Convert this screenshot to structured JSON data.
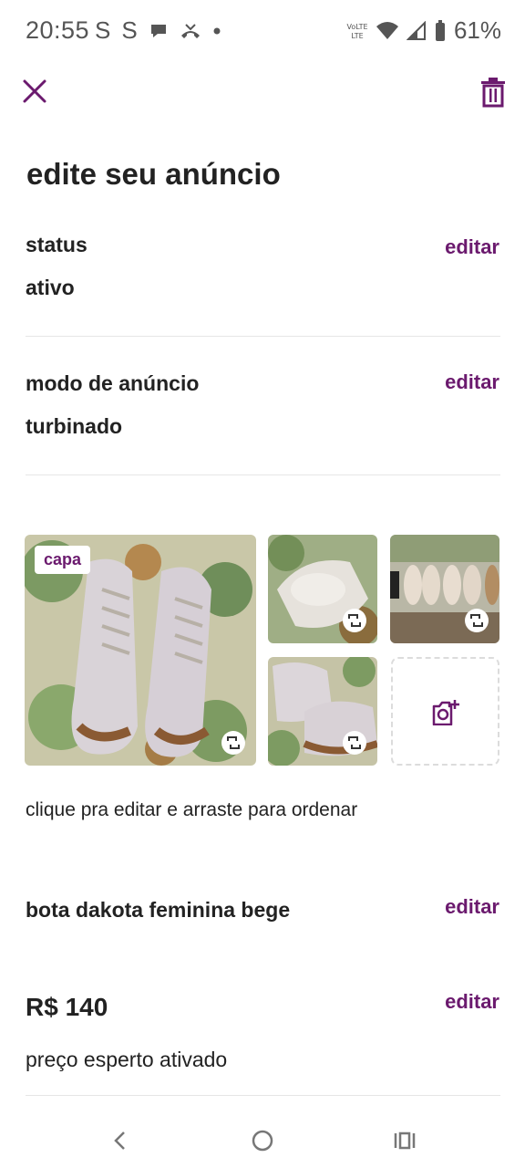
{
  "status_bar": {
    "time": "20:55",
    "left_icons": [
      "S",
      "S"
    ],
    "battery_text": "61%"
  },
  "header": {
    "title": "edite seu anúncio"
  },
  "status_row": {
    "label": "status",
    "value": "ativo",
    "edit_label": "editar"
  },
  "mode_row": {
    "label": "modo de anúncio",
    "value": "turbinado",
    "edit_label": "editar"
  },
  "photos": {
    "cover_badge": "capa",
    "hint": "clique pra editar e arraste para ordenar"
  },
  "title_row": {
    "value": "bota dakota feminina bege",
    "edit_label": "editar"
  },
  "price_row": {
    "value": "R$ 140",
    "subtitle": "preço esperto ativado",
    "edit_label": "editar"
  },
  "colors": {
    "accent": "#6b1a6e"
  }
}
